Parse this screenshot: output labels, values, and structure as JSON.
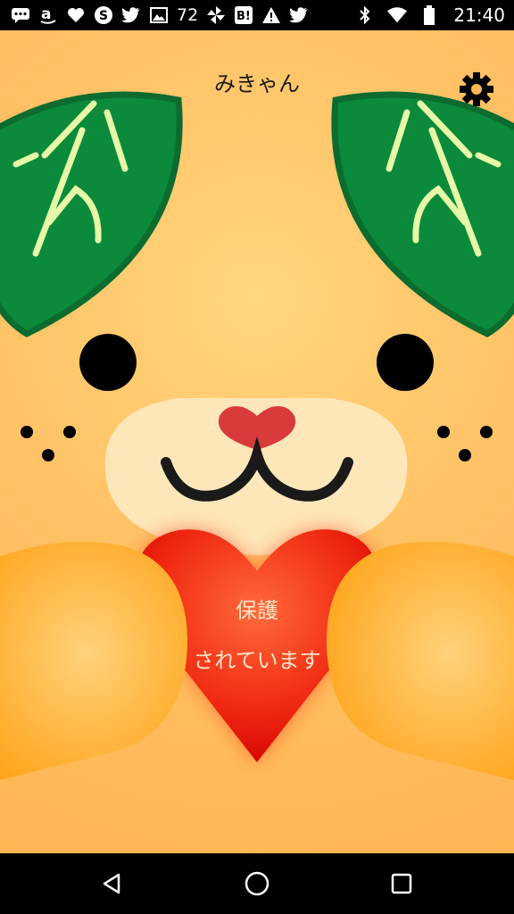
{
  "status_bar": {
    "notification_icons": [
      "chat-icon",
      "amazon-icon",
      "heart-icon",
      "skype-icon",
      "twitter-icon",
      "image-icon"
    ],
    "notification_count": "72",
    "more_icons": [
      "pinwheel-icon",
      "hatena-bookmark-icon",
      "warning-icon",
      "twitter-icon"
    ],
    "system_icons": [
      "bluetooth-icon",
      "wifi-icon",
      "battery-icon"
    ],
    "time": "21:40"
  },
  "app": {
    "title": "みきゃん",
    "settings_icon": "gear-icon",
    "heart_status_line1": "保護",
    "heart_status_line2": "されています",
    "colors": {
      "background": "#ffbf62",
      "leaf": "#0a8a3a",
      "leaf_outline": "#0c6b2e",
      "leaf_vein": "#e6f7a8",
      "muzzle": "#fde6b8",
      "nose": "#d93a3a",
      "heart": "#ff3b1a",
      "paw": "#ffae38"
    }
  },
  "nav_bar": {
    "back_icon": "back-triangle-icon",
    "home_icon": "home-circle-icon",
    "recents_icon": "recents-square-icon"
  }
}
